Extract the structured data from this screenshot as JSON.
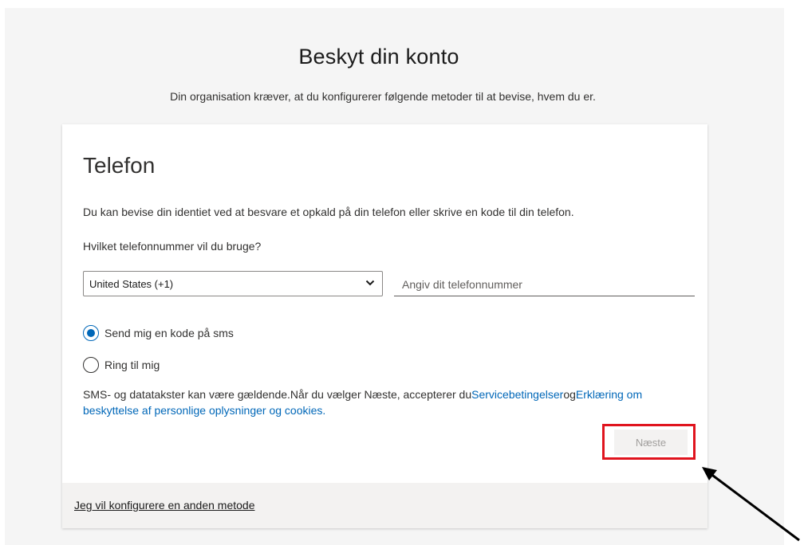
{
  "header": {
    "title": "Beskyt din konto",
    "subtitle": "Din organisation kræver, at du konfigurerer følgende metoder til at bevise, hvem du er."
  },
  "card": {
    "heading": "Telefon",
    "description": "Du kan bevise din identiet ved at besvare et opkald på din telefon eller skrive en kode til din telefon.",
    "question": "Hvilket telefonnummer vil du bruge?",
    "country_select": {
      "value": "United States (+1)",
      "icon": "chevron-down-icon"
    },
    "phone_input": {
      "value": "",
      "placeholder": "Angiv dit telefonnummer"
    },
    "methods": [
      {
        "label": "Send mig en kode på sms",
        "checked": true
      },
      {
        "label": "Ring til mig",
        "checked": false
      }
    ],
    "terms": {
      "text": "SMS- og datatakster kan være gældende.Når du vælger Næste, accepterer du",
      "link1": "Servicebetingelser",
      "joiner": "og",
      "link2": "Erklæring om beskyttelse af personlige oplysninger og cookies."
    },
    "next_button": "Næste",
    "footer_link": "Jeg vil konfigurere en anden metode"
  },
  "colors": {
    "accent": "#0067b8",
    "highlight": "#e0141e",
    "annotation_arrow": "#000000"
  }
}
